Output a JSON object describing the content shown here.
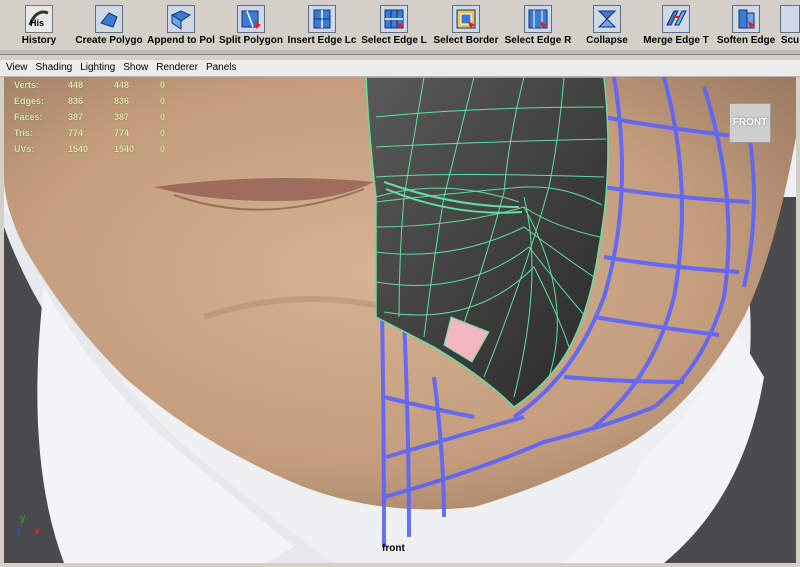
{
  "shelf": {
    "tools": [
      {
        "name": "history",
        "label": "History",
        "icon": "history-icon",
        "badge": "His"
      },
      {
        "name": "create-polygon",
        "label": "Create Polygo",
        "icon": "create-polygon-icon"
      },
      {
        "name": "append-to-polygon",
        "label": "Append to Pol",
        "icon": "append-polygon-icon"
      },
      {
        "name": "split-polygon",
        "label": "Split Polygon ",
        "icon": "split-polygon-icon"
      },
      {
        "name": "insert-edge-loop",
        "label": "Insert Edge Lc",
        "icon": "insert-edge-loop-icon"
      },
      {
        "name": "select-edge-loop",
        "label": "Select Edge L",
        "icon": "select-edge-loop-icon"
      },
      {
        "name": "select-border",
        "label": "Select Border",
        "icon": "select-border-icon"
      },
      {
        "name": "select-edge-ring",
        "label": "Select Edge R",
        "icon": "select-edge-ring-icon"
      },
      {
        "name": "collapse",
        "label": "Collapse",
        "icon": "collapse-icon"
      },
      {
        "name": "merge-edge",
        "label": "Merge Edge T",
        "icon": "merge-edge-icon"
      },
      {
        "name": "soften-edge",
        "label": "Soften Edge",
        "icon": "soften-edge-icon"
      },
      {
        "name": "sculpt",
        "label": "Scu",
        "icon": "sculpt-icon"
      }
    ]
  },
  "panel_menu": [
    "View",
    "Shading",
    "Lighting",
    "Show",
    "Renderer",
    "Panels"
  ],
  "hud": {
    "rows": [
      {
        "label": "Verts:",
        "a": "448",
        "b": "448",
        "c": "0"
      },
      {
        "label": "Edges:",
        "a": "836",
        "b": "836",
        "c": "0"
      },
      {
        "label": "Faces:",
        "a": "387",
        "b": "387",
        "c": "0"
      },
      {
        "label": "Tris:",
        "a": "774",
        "b": "774",
        "c": "0"
      },
      {
        "label": "UVs:",
        "a": "1540",
        "b": "1540",
        "c": "0"
      }
    ]
  },
  "view_cube_label": "FRONT",
  "camera_label": "front",
  "axis": {
    "y": "y",
    "z": "z",
    "x": "x"
  },
  "colors": {
    "wireframe": "#5fe0a0",
    "blue_wire": "#5a63ff",
    "mesh_fill": "#4a4a4a",
    "selected_face": "#f4b7c1",
    "skin": "#caa584",
    "shirt": "#eef0f2"
  }
}
